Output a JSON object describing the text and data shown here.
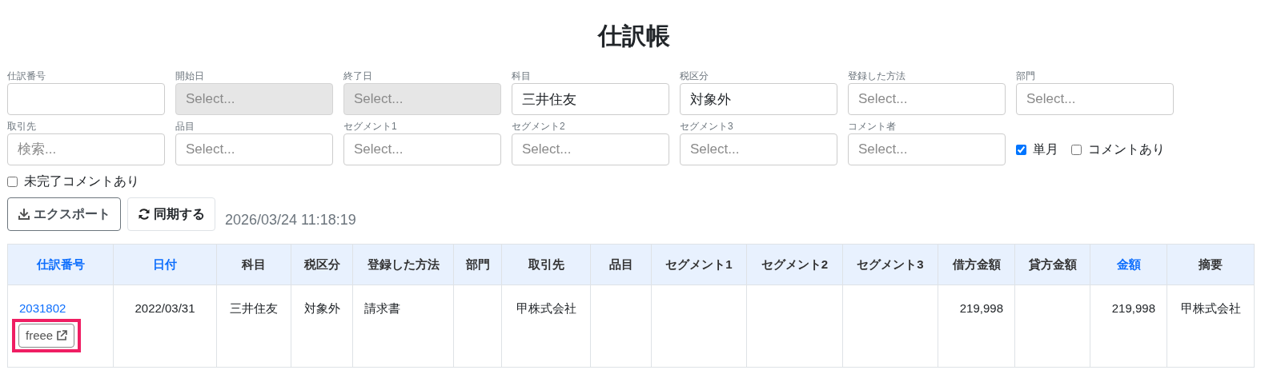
{
  "title": "仕訳帳",
  "filters": [
    {
      "label": "仕訳番号",
      "disabled": false
    },
    {
      "label": "開始日",
      "placeholder": "Select...",
      "disabled": true
    },
    {
      "label": "終了日",
      "placeholder": "Select...",
      "disabled": true
    },
    {
      "label": "科目",
      "value": "三井住友",
      "disabled": false
    },
    {
      "label": "税区分",
      "value": "対象外",
      "disabled": false
    },
    {
      "label": "登録した方法",
      "placeholder": "Select...",
      "disabled": false
    },
    {
      "label": "部門",
      "placeholder": "Select...",
      "disabled": false
    },
    {
      "label": "取引先",
      "placeholder": "検索...",
      "disabled": false
    },
    {
      "label": "品目",
      "placeholder": "Select...",
      "disabled": false
    },
    {
      "label": "セグメント1",
      "placeholder": "Select...",
      "disabled": false
    },
    {
      "label": "セグメント2",
      "placeholder": "Select...",
      "disabled": false
    },
    {
      "label": "セグメント3",
      "placeholder": "Select...",
      "disabled": false
    },
    {
      "label": "コメント者",
      "placeholder": "Select...",
      "disabled": false
    }
  ],
  "inline_checks": [
    {
      "label": "単月",
      "checked": true
    },
    {
      "label": "コメントあり",
      "checked": false
    }
  ],
  "extra_check": {
    "label": "未完了コメントあり",
    "checked": false
  },
  "actions": [
    {
      "kind": "download",
      "label": "エクスポート"
    },
    {
      "kind": "sync",
      "label": "同期する"
    }
  ],
  "synced_at": "2026/03/24 11:18:19",
  "table": {
    "columns": [
      {
        "label": "仕訳番号",
        "sortable": true
      },
      {
        "label": "日付",
        "sortable": true
      },
      {
        "label": "科目",
        "sortable": false
      },
      {
        "label": "税区分",
        "sortable": false
      },
      {
        "label": "登録した方法",
        "sortable": false
      },
      {
        "label": "部門",
        "sortable": false
      },
      {
        "label": "取引先",
        "sortable": false
      },
      {
        "label": "品目",
        "sortable": false
      },
      {
        "label": "セグメント1",
        "sortable": false
      },
      {
        "label": "セグメント2",
        "sortable": false
      },
      {
        "label": "セグメント3",
        "sortable": false
      },
      {
        "label": "借方金額",
        "sortable": false
      },
      {
        "label": "貸方金額",
        "sortable": false
      },
      {
        "label": "金額",
        "sortable": true
      },
      {
        "label": "摘要",
        "sortable": false
      }
    ],
    "rows": [
      {
        "button": {
          "label": "freee",
          "highlighted": true
        },
        "cells": [
          "2031802",
          "2022/03/31",
          "三井住友",
          "対象外",
          "請求書",
          "",
          "甲株式会社",
          "",
          "",
          "",
          "",
          "219,998",
          "",
          "219,998",
          "甲株式会社"
        ]
      }
    ]
  }
}
